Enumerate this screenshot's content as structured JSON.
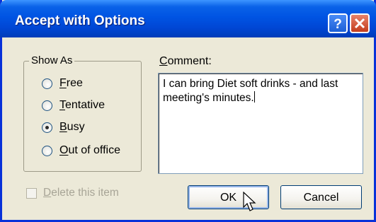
{
  "window": {
    "title": "Accept with Options",
    "help_symbol": "?",
    "close_icon": "close-icon"
  },
  "show_as": {
    "legend": "Show As",
    "options": [
      {
        "label": "Free",
        "selected": false
      },
      {
        "label": "Tentative",
        "selected": false
      },
      {
        "label": "Busy",
        "selected": true
      },
      {
        "label": "Out of office",
        "selected": false
      }
    ]
  },
  "comment": {
    "label": "Comment:",
    "value": "I can bring Diet soft drinks - and last meeting's minutes."
  },
  "delete_item": {
    "label": "Delete this item",
    "checked": false,
    "disabled": true
  },
  "buttons": {
    "ok": "OK",
    "cancel": "Cancel"
  },
  "colors": {
    "titlebar": "#0054e3",
    "dialog_bg": "#ece9d8",
    "close_button": "#c43d1c",
    "disabled_text": "#a8a597"
  }
}
